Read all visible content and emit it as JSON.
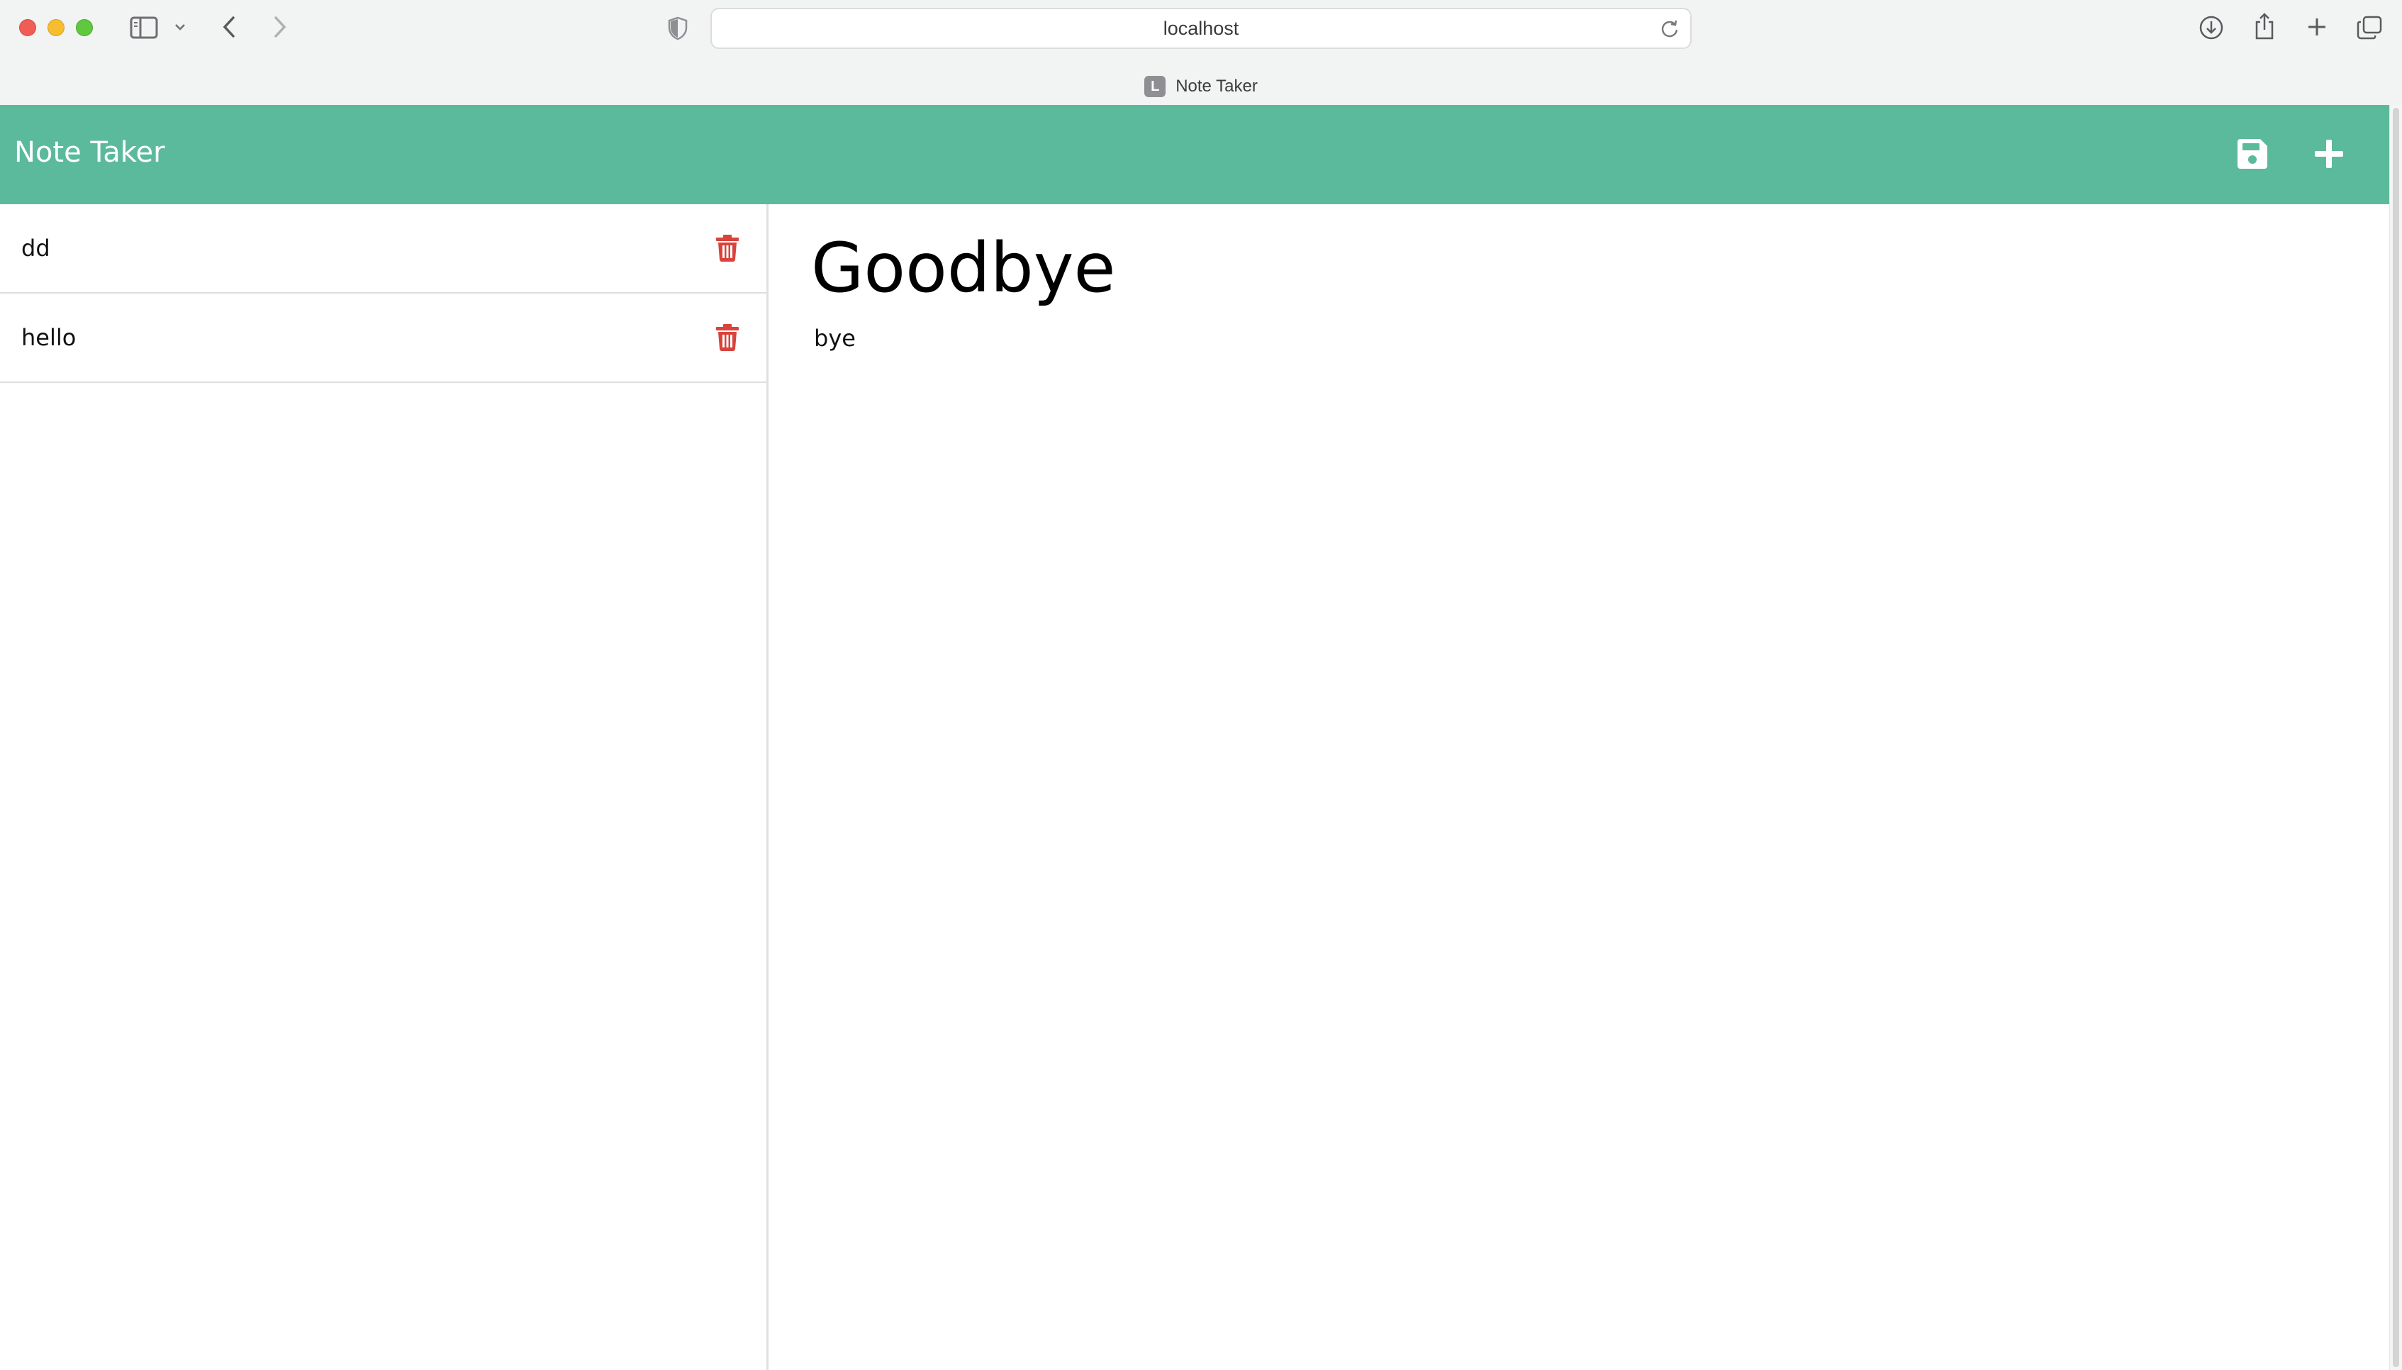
{
  "browser": {
    "url": "localhost",
    "tab": {
      "favicon_letter": "L",
      "title": "Note Taker"
    }
  },
  "app": {
    "brand": "Note Taker",
    "accent_color": "#5bba9c",
    "delete_color": "#d9433b"
  },
  "notes": [
    {
      "title": "dd"
    },
    {
      "title": "hello"
    }
  ],
  "active_note": {
    "title": "Goodbye",
    "text": "bye"
  }
}
